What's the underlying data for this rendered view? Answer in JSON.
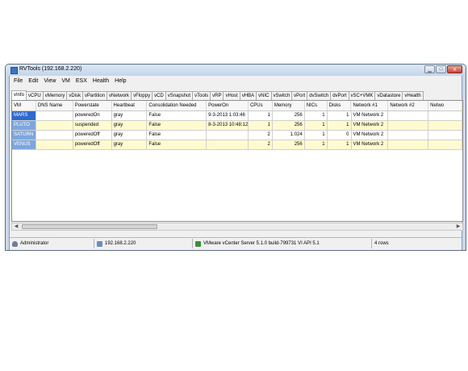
{
  "window": {
    "title": "RVTools (192.168.2.220)"
  },
  "menu": [
    "File",
    "Edit",
    "View",
    "VM",
    "ESX",
    "Health",
    "Help"
  ],
  "tabs": [
    "vInfo",
    "vCPU",
    "vMemory",
    "vDisk",
    "vPartition",
    "vNetwork",
    "vFloppy",
    "vCD",
    "vSnapshot",
    "vTools",
    "vRP",
    "vHost",
    "vHBA",
    "vNIC",
    "vSwitch",
    "vPort",
    "dvSwitch",
    "dvPort",
    "vSC+VMK",
    "vDatastore",
    "vHealth"
  ],
  "grid": {
    "columns": [
      "VM",
      "DNS Name",
      "Powerstate",
      "Heartbeat",
      "Consolidation Needed",
      "PowerOn",
      "CPUs",
      "Memory",
      "NICs",
      "Disks",
      "Network #1",
      "Network #2",
      "Netwo"
    ],
    "rows": [
      [
        "MARS",
        "",
        "poweredOn",
        "gray",
        "False",
        "9-3-2013 1:03:46",
        "1",
        "256",
        "1",
        "1",
        "VM Network 2",
        "",
        ""
      ],
      [
        "PLUTO",
        "",
        "suspended",
        "gray",
        "False",
        "8-3-2013 10:48:12",
        "1",
        "256",
        "1",
        "1",
        "VM Network 2",
        "",
        ""
      ],
      [
        "SATURN",
        "",
        "poweredOff",
        "gray",
        "False",
        "",
        "2",
        "1.024",
        "1",
        "0",
        "VM Network 2",
        "",
        ""
      ],
      [
        "VENUS",
        "",
        "poweredOff",
        "gray",
        "False",
        "",
        "2",
        "256",
        "1",
        "1",
        "VM Network 2",
        "",
        ""
      ]
    ]
  },
  "status": {
    "user": "Administrator",
    "host": "192.168.2.220",
    "server": "VMware vCenter Server 5.1.0 build-799731  VI API 5.1",
    "rows": "4 rows"
  },
  "icons": {
    "app": "rvtools-app-icon",
    "minimize": "minimize-icon",
    "maximize": "maximize-icon",
    "close": "close-icon",
    "user": "user-icon",
    "host": "network-icon",
    "server": "vmware-icon"
  },
  "colors": {
    "alt_row": "#fffbd0",
    "selected_vm": "#2e6ad0"
  }
}
